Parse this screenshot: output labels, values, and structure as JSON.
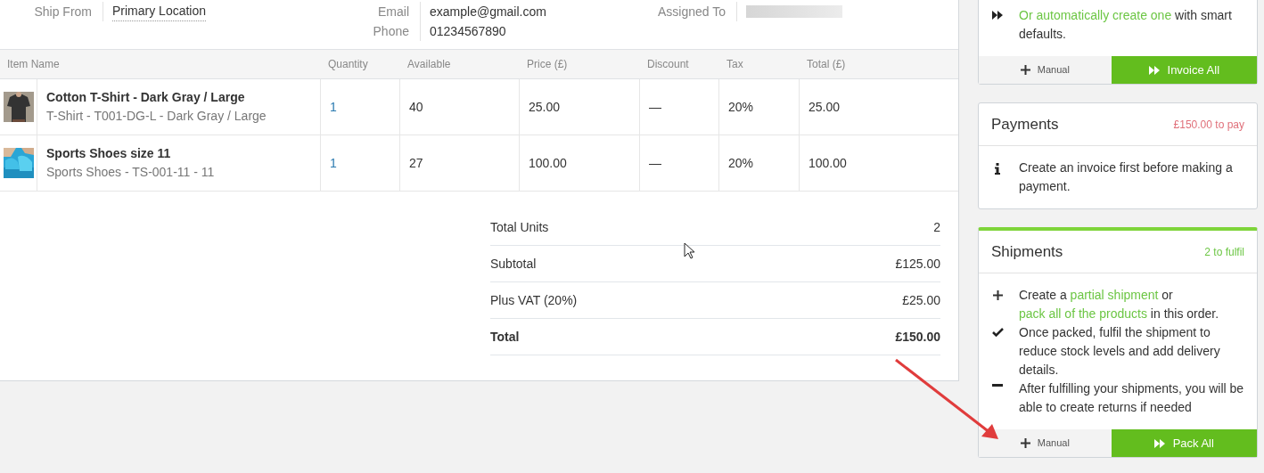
{
  "order_info": [
    [
      {
        "label": "Ship From",
        "value": "Primary Location",
        "kind": "link"
      }
    ],
    [
      {
        "label": "Email",
        "value": "example@gmail.com",
        "kind": "text"
      },
      {
        "label": "Phone",
        "value": "01234567890",
        "kind": "text"
      }
    ],
    [
      {
        "label": "Assigned To",
        "kind": "redacted"
      }
    ]
  ],
  "table": {
    "columns": [
      "Item Name",
      "Quantity",
      "Available",
      "Price (£)",
      "Discount",
      "Tax",
      "Total (£)"
    ],
    "rows": [
      {
        "kind": "shirt",
        "name": "Cotton T-Shirt - Dark Gray / Large",
        "variant": "T-Shirt - T001-DG-L - Dark Gray / Large",
        "quantity": "1",
        "available": "40",
        "price": "25.00",
        "discount": "—",
        "tax": "20%",
        "total": "25.00"
      },
      {
        "kind": "shoes",
        "name": "Sports Shoes size 11",
        "variant": "Sports Shoes - TS-001-11 - 11",
        "quantity": "1",
        "available": "27",
        "price": "100.00",
        "discount": "—",
        "tax": "20%",
        "total": "100.00"
      }
    ]
  },
  "totals": [
    {
      "label": "Total Units",
      "value": "2",
      "bold": false
    },
    {
      "label": "Subtotal",
      "value": "£125.00",
      "bold": false
    },
    {
      "label": "Plus VAT (20%)",
      "value": "£25.00",
      "bold": false
    },
    {
      "label": "Total",
      "value": "£150.00",
      "bold": true
    }
  ],
  "cards": [
    {
      "accent": false,
      "steps": [
        {
          "kind": "auto",
          "segments": [
            {
              "text": "Or automatically create one",
              "link": true
            },
            {
              "text": " with smart defaults.",
              "link": false
            }
          ]
        }
      ],
      "buttons": [
        {
          "kind": "secondary",
          "label": "Manual"
        },
        {
          "kind": "primary",
          "label": "Invoice All"
        }
      ]
    },
    {
      "accent": false,
      "title": "Payments",
      "badge": "£150.00 to pay",
      "color": "#e0707a",
      "steps": [
        {
          "kind": "info",
          "segments": [
            {
              "text": "Create an invoice first before making a payment.",
              "link": false
            }
          ]
        }
      ]
    },
    {
      "accent": true,
      "title": "Shipments",
      "badge": "2 to fulfil",
      "color": "#6cc644",
      "steps": [
        {
          "kind": "create",
          "segments": [
            {
              "text": "Create a ",
              "link": false
            },
            {
              "text": "partial shipment",
              "link": true
            },
            {
              "text": " or ",
              "link": false
            },
            {
              "text": "pack all of the products",
              "link": true
            },
            {
              "text": " in this order.",
              "link": false
            }
          ]
        },
        {
          "kind": "done",
          "segments": [
            {
              "text": "Once packed, fulfil the shipment to reduce stock levels and add delivery details.",
              "link": false
            }
          ]
        },
        {
          "kind": "after",
          "segments": [
            {
              "text": "After fulfilling your shipments, you will be able to create returns if needed",
              "link": false
            }
          ]
        }
      ],
      "buttons": [
        {
          "kind": "secondary",
          "label": "Manual"
        },
        {
          "kind": "primary",
          "label": "Pack All"
        }
      ]
    }
  ]
}
